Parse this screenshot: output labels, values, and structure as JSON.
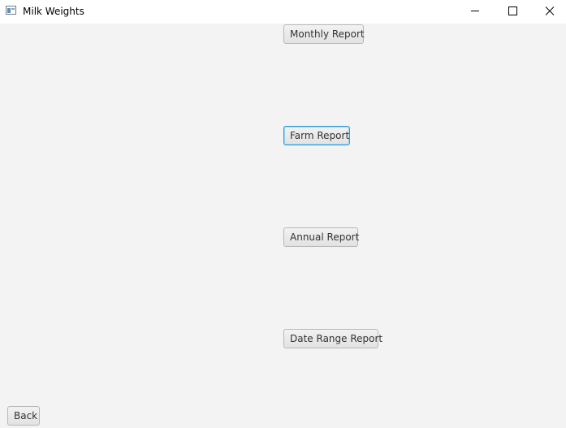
{
  "window": {
    "title": "Milk Weights",
    "icon": "app-window-icon"
  },
  "controls": {
    "minimize_icon": "minimize-icon",
    "maximize_icon": "maximize-icon",
    "close_icon": "close-icon"
  },
  "buttons": {
    "monthly": "Monthly Report",
    "farm": "Farm Report",
    "annual": "Annual Report",
    "date_range": "Date Range Report",
    "back": "Back"
  },
  "colors": {
    "background": "#f3f3f3",
    "titlebar": "#ffffff",
    "focus_border": "#2f9ad8"
  }
}
